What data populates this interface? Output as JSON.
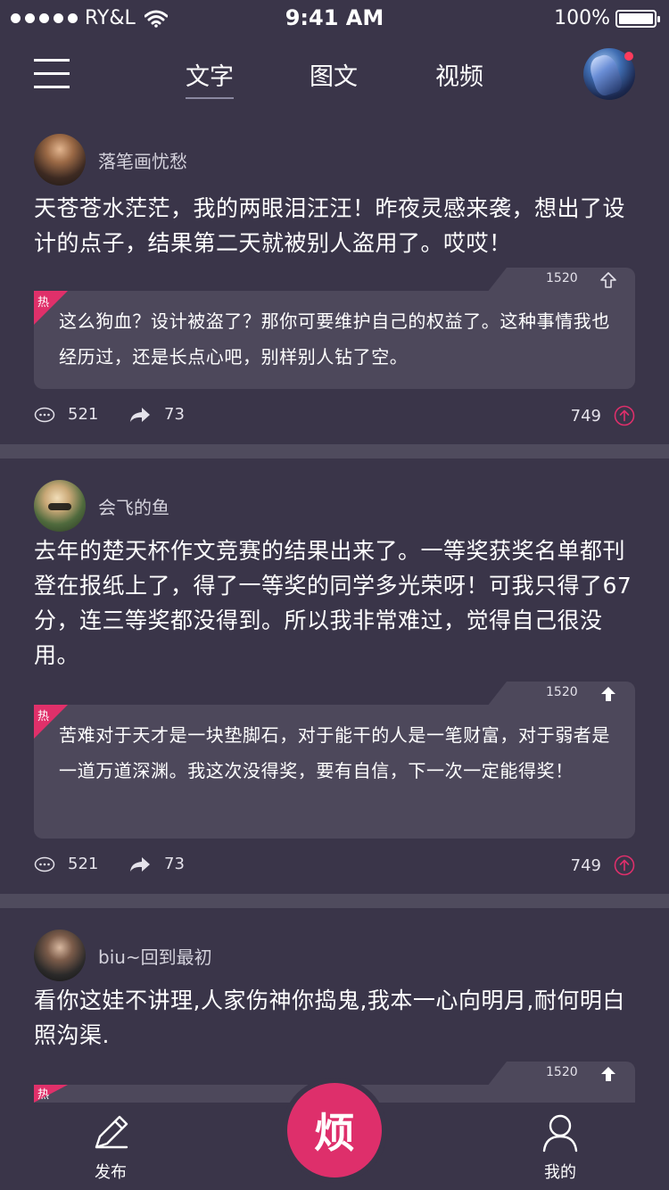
{
  "status_bar": {
    "carrier": "RY&L",
    "time": "9:41 AM",
    "battery": "100%",
    "battery_level": 1.0
  },
  "header": {
    "tabs": [
      {
        "label": "文字",
        "active": true
      },
      {
        "label": "图文",
        "active": false
      },
      {
        "label": "视频",
        "active": false
      }
    ],
    "has_notification": true
  },
  "posts": [
    {
      "author": "落笔画忧愁",
      "body": "天苍苍水茫茫，我的两眼泪汪汪！昨夜灵感来袭，想出了设计的点子，结果第二天就被别人盗用了。哎哎！",
      "hot_comment": {
        "badge": "热",
        "likes": "1520",
        "text": "这么狗血？设计被盗了？那你可要维护自己的权益了。这种事情我也经历过，还是长点心吧，别样别人钻了空。"
      },
      "comments": "521",
      "shares": "73",
      "votes": "749"
    },
    {
      "author": "会飞的鱼",
      "body": "去年的楚天杯作文竞赛的结果出来了。一等奖获奖名单都刊登在报纸上了，得了一等奖的同学多光荣呀！可我只得了67分，连三等奖都没得到。所以我非常难过，觉得自己很没用。",
      "hot_comment": {
        "badge": "热",
        "likes": "1520",
        "text": "苦难对于天才是一块垫脚石，对于能干的人是一笔财富，对于弱者是一道万道深渊。我这次没得奖，要有自信，下一次一定能得奖！"
      },
      "comments": "521",
      "shares": "73",
      "votes": "749"
    },
    {
      "author": "biu~回到最初",
      "body": "看你这娃不讲理,人家伤神你捣鬼,我本一心向明月,耐何明白照沟渠.",
      "hot_comment": {
        "badge": "热",
        "likes": "1520",
        "text": ""
      }
    }
  ],
  "tab_bar": {
    "publish": "发布",
    "fab": "烦",
    "mine": "我的"
  },
  "colors": {
    "background": "#3a3549",
    "card": "#4d485b",
    "accent": "#de2f6b",
    "divider": "#4f4b5d"
  },
  "icons": [
    "menu-icon",
    "wifi-icon",
    "battery-icon",
    "comment-icon",
    "share-icon",
    "upvote-icon",
    "like-arrow-icon",
    "pen-icon",
    "user-icon"
  ]
}
